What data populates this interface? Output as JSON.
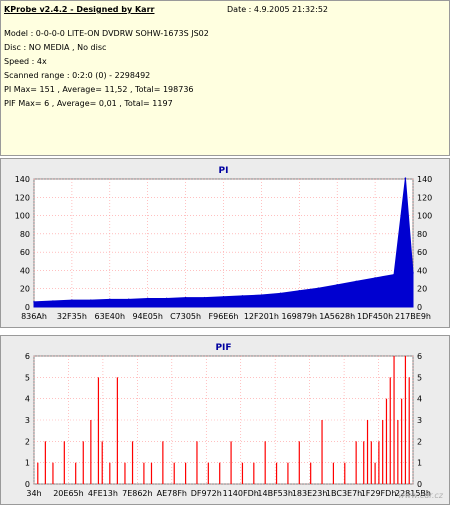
{
  "header": {
    "app_title": "KProbe v2.4.2 - Designed by Karr",
    "date": "Date : 4.9.2005 21:32:52",
    "model": "Model : 0-0-0-0 LITE-ON DVDRW SOHW-1673S JS02",
    "disc": "Disc : NO MEDIA , No disc",
    "speed": "Speed : 4x",
    "scanned_range": "Scanned range : 0:2:0 (0) - 2298492",
    "pi_stats": "PI Max= 151 , Average= 11,52 , Total= 198736",
    "pif_stats": "PIF Max= 6 , Average= 0,01 , Total= 1197"
  },
  "watermark": "www.cdr.cz",
  "colors": {
    "pi": "#0000d0",
    "pif": "#ff0000",
    "plot_bg": "#ffffff",
    "grid": "#ff9a9a",
    "title": "#0000a0"
  },
  "chart_data": [
    {
      "type": "area",
      "title": "PI",
      "ylim": [
        0,
        150
      ],
      "yticks": [
        "0",
        "20",
        "40",
        "60",
        "80",
        "100",
        "120",
        "140"
      ],
      "xticks": [
        "836Ah",
        "32F35h",
        "63E40h",
        "94E05h",
        "C7305h",
        "F96E6h",
        "12F201h",
        "169879h",
        "1A5628h",
        "1DF450h",
        "217BE9h"
      ],
      "x": [
        0,
        5,
        10,
        15,
        20,
        25,
        30,
        35,
        40,
        45,
        50,
        55,
        60,
        65,
        70,
        75,
        80,
        85,
        90,
        95,
        98,
        100
      ],
      "values": [
        6,
        7,
        8,
        8,
        9,
        9,
        10,
        10,
        11,
        11,
        12,
        13,
        14,
        16,
        19,
        22,
        26,
        30,
        34,
        38,
        151,
        40
      ],
      "grid": true,
      "max": 151
    },
    {
      "type": "bar",
      "title": "PIF",
      "ylim": [
        0,
        6
      ],
      "yticks": [
        "0",
        "1",
        "2",
        "3",
        "4",
        "5",
        "6"
      ],
      "xticks": [
        "34h",
        "20E65h",
        "4FE13h",
        "7E862h",
        "AE78Fh",
        "DF972h",
        "1140FDh",
        "14BF53h",
        "183E23h",
        "1BC3E7h",
        "1F29FDh",
        "22815Bh"
      ],
      "x": [
        1,
        3,
        5,
        8,
        11,
        13,
        15,
        17,
        18,
        20,
        22,
        24,
        26,
        29,
        31,
        34,
        37,
        40,
        43,
        46,
        49,
        52,
        55,
        58,
        61,
        64,
        67,
        70,
        73,
        76,
        79,
        82,
        85,
        87,
        88,
        89,
        90,
        91,
        92,
        93,
        94,
        95,
        96,
        97,
        98,
        99
      ],
      "values": [
        1,
        2,
        1,
        2,
        1,
        2,
        3,
        5,
        2,
        1,
        5,
        1,
        2,
        1,
        1,
        2,
        1,
        1,
        2,
        1,
        1,
        2,
        1,
        1,
        2,
        1,
        1,
        2,
        1,
        3,
        1,
        1,
        2,
        2,
        3,
        2,
        1,
        2,
        3,
        4,
        5,
        6,
        3,
        4,
        6,
        5
      ],
      "grid": true
    }
  ]
}
